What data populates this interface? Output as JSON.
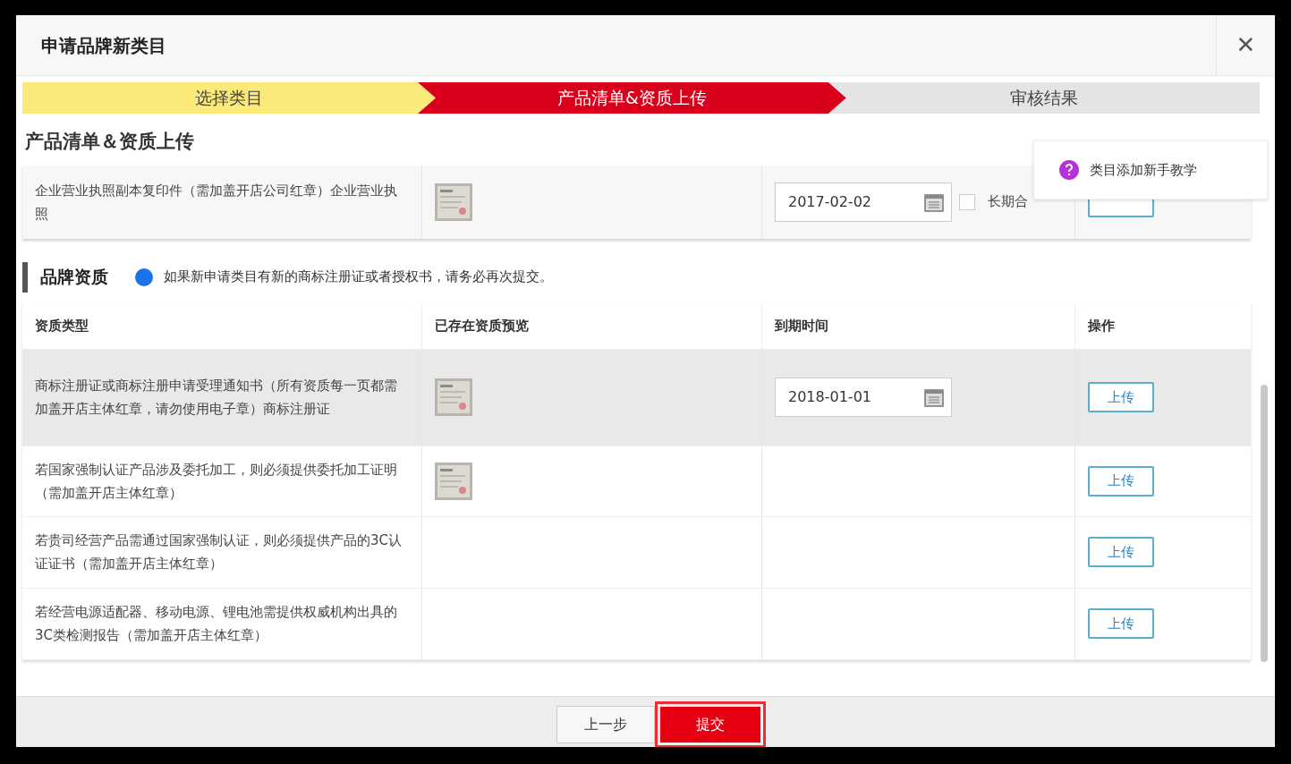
{
  "dialog": {
    "title": "申请品牌新类目",
    "close": "✕"
  },
  "steps": [
    {
      "label": "选择类目",
      "selected": false
    },
    {
      "label": "产品清单&资质上传",
      "selected": true
    },
    {
      "label": "审核结果",
      "selected": false
    }
  ],
  "section_title": "产品清单＆资质上传",
  "license_row": {
    "name": "企业营业执照副本复印件（需加盖开店公司红章）企业营业执照",
    "preview": true,
    "date": "2017-02-02",
    "long_term": {
      "label": "长期合",
      "checked": false
    }
  },
  "brand_section": {
    "title": "品牌资质",
    "note": "如果新申请类目有新的商标注册证或者授权书，请务必再次提交。"
  },
  "table": {
    "columns": [
      "资质类型",
      "已存在资质预览",
      "到期时间",
      "操作"
    ],
    "rows": [
      {
        "name": "商标注册证或商标注册申请受理通知书（所有资质每一页都需加盖开店主体红章，请勿使用电子章）商标注册证",
        "preview": true,
        "date": "2018-01-01",
        "action": "上传",
        "hovered": true
      },
      {
        "name": "若国家强制认证产品涉及委托加工，则必须提供委托加工证明（需加盖开店主体红章）",
        "preview": true,
        "action": "上传",
        "hovered": false
      },
      {
        "name": "若贵司经营产品需通过国家强制认证，则必须提供产品的3C认证证书（需加盖开店主体红章）",
        "preview": false,
        "action": "上传",
        "hovered": false
      },
      {
        "name": "若经营电源适配器、移动电源、锂电池需提供权威机构出具的3C类检测报告（需加盖开店主体红章）",
        "preview": false,
        "action": "上传",
        "hovered": false
      }
    ]
  },
  "footer_buttons": [
    {
      "label": "上一步",
      "kind": "secondary"
    },
    {
      "label": "提交",
      "kind": "primary"
    }
  ],
  "help_popup": {
    "text": "类目添加新手教学"
  }
}
